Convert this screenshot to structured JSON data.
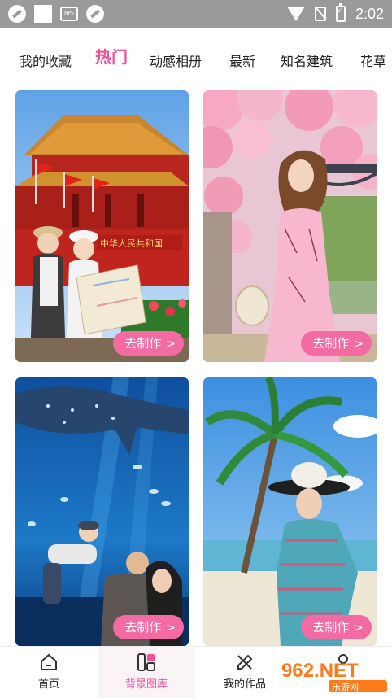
{
  "status_bar": {
    "time": "2:02",
    "nps_label": "NPS"
  },
  "tabs": [
    {
      "label": "我的收藏"
    },
    {
      "label": "热门"
    },
    {
      "label": "动感相册"
    },
    {
      "label": "最新"
    },
    {
      "label": "知名建筑"
    },
    {
      "label": "花草"
    }
  ],
  "cards": [
    {
      "button_label": "去制作",
      "sign_text": "中华人民共和国"
    },
    {
      "button_label": "去制作"
    },
    {
      "button_label": "去制作"
    },
    {
      "button_label": "去制作"
    }
  ],
  "bottom_nav": [
    {
      "label": "首页"
    },
    {
      "label": "背景图库"
    },
    {
      "label": "我的作品"
    }
  ],
  "watermark": {
    "text": "962.NET",
    "sub_text": "乐游网"
  },
  "colors": {
    "accent": "#f0509a",
    "button_bg": "#f46ba3",
    "status_bar": "#9a9a9a"
  }
}
